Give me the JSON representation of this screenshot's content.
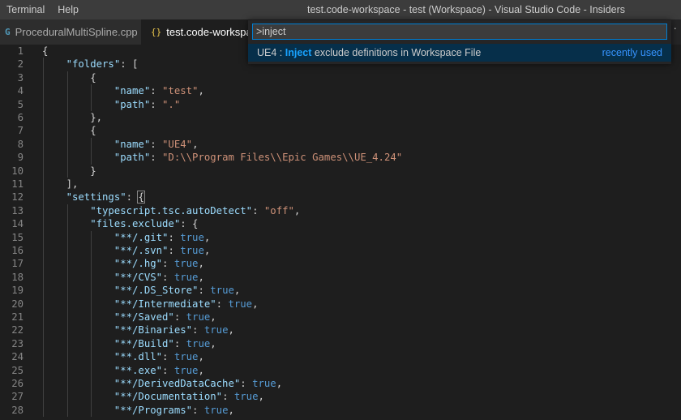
{
  "menu": {
    "items": [
      "Terminal",
      "Help"
    ]
  },
  "window": {
    "title": "test.code-workspace - test (Workspace) - Visual Studio Code - Insiders"
  },
  "tabs": [
    {
      "label": "ProceduralMultiSpline.cpp",
      "icon": "cpp-file-icon",
      "icon_glyph": "G"
    },
    {
      "label": "test.code-workspace",
      "icon": "json-braces-icon",
      "icon_glyph": "{}"
    }
  ],
  "more_actions": "···",
  "palette": {
    "input_value": ">inject",
    "result": {
      "prefix": "UE4 : ",
      "match": "Inject",
      "rest": " exclude definitions in Workspace File",
      "badge": "recently used"
    }
  },
  "editor": {
    "lines": [
      {
        "n": "1",
        "indent": 0,
        "tokens": [
          [
            "p",
            "{"
          ]
        ]
      },
      {
        "n": "2",
        "indent": 1,
        "tokens": [
          [
            "k",
            "\"folders\""
          ],
          [
            "p",
            ": ["
          ]
        ]
      },
      {
        "n": "3",
        "indent": 2,
        "tokens": [
          [
            "p",
            "{"
          ]
        ]
      },
      {
        "n": "4",
        "indent": 3,
        "tokens": [
          [
            "k",
            "\"name\""
          ],
          [
            "p",
            ": "
          ],
          [
            "s",
            "\"test\""
          ],
          [
            "p",
            ","
          ]
        ]
      },
      {
        "n": "5",
        "indent": 3,
        "tokens": [
          [
            "k",
            "\"path\""
          ],
          [
            "p",
            ": "
          ],
          [
            "s",
            "\".\""
          ]
        ]
      },
      {
        "n": "6",
        "indent": 2,
        "tokens": [
          [
            "p",
            "},"
          ]
        ]
      },
      {
        "n": "7",
        "indent": 2,
        "tokens": [
          [
            "p",
            "{"
          ]
        ]
      },
      {
        "n": "8",
        "indent": 3,
        "tokens": [
          [
            "k",
            "\"name\""
          ],
          [
            "p",
            ": "
          ],
          [
            "s",
            "\"UE4\""
          ],
          [
            "p",
            ","
          ]
        ]
      },
      {
        "n": "9",
        "indent": 3,
        "tokens": [
          [
            "k",
            "\"path\""
          ],
          [
            "p",
            ": "
          ],
          [
            "s",
            "\"D:\\\\Program Files\\\\Epic Games\\\\UE_4.24\""
          ]
        ]
      },
      {
        "n": "10",
        "indent": 2,
        "tokens": [
          [
            "p",
            "}"
          ]
        ]
      },
      {
        "n": "11",
        "indent": 1,
        "tokens": [
          [
            "p",
            "],"
          ]
        ]
      },
      {
        "n": "12",
        "indent": 1,
        "tokens": [
          [
            "k",
            "\"settings\""
          ],
          [
            "p",
            ": "
          ],
          [
            "h",
            "{"
          ]
        ]
      },
      {
        "n": "13",
        "indent": 2,
        "tokens": [
          [
            "k",
            "\"typescript.tsc.autoDetect\""
          ],
          [
            "p",
            ": "
          ],
          [
            "s",
            "\"off\""
          ],
          [
            "p",
            ","
          ]
        ]
      },
      {
        "n": "14",
        "indent": 2,
        "tokens": [
          [
            "k",
            "\"files.exclude\""
          ],
          [
            "p",
            ": {"
          ]
        ]
      },
      {
        "n": "15",
        "indent": 3,
        "tokens": [
          [
            "k",
            "\"**/.git\""
          ],
          [
            "p",
            ": "
          ],
          [
            "b",
            "true"
          ],
          [
            "p",
            ","
          ]
        ]
      },
      {
        "n": "16",
        "indent": 3,
        "tokens": [
          [
            "k",
            "\"**/.svn\""
          ],
          [
            "p",
            ": "
          ],
          [
            "b",
            "true"
          ],
          [
            "p",
            ","
          ]
        ]
      },
      {
        "n": "17",
        "indent": 3,
        "tokens": [
          [
            "k",
            "\"**/.hg\""
          ],
          [
            "p",
            ": "
          ],
          [
            "b",
            "true"
          ],
          [
            "p",
            ","
          ]
        ]
      },
      {
        "n": "18",
        "indent": 3,
        "tokens": [
          [
            "k",
            "\"**/CVS\""
          ],
          [
            "p",
            ": "
          ],
          [
            "b",
            "true"
          ],
          [
            "p",
            ","
          ]
        ]
      },
      {
        "n": "19",
        "indent": 3,
        "tokens": [
          [
            "k",
            "\"**/.DS_Store\""
          ],
          [
            "p",
            ": "
          ],
          [
            "b",
            "true"
          ],
          [
            "p",
            ","
          ]
        ]
      },
      {
        "n": "20",
        "indent": 3,
        "tokens": [
          [
            "k",
            "\"**/Intermediate\""
          ],
          [
            "p",
            ": "
          ],
          [
            "b",
            "true"
          ],
          [
            "p",
            ","
          ]
        ]
      },
      {
        "n": "21",
        "indent": 3,
        "tokens": [
          [
            "k",
            "\"**/Saved\""
          ],
          [
            "p",
            ": "
          ],
          [
            "b",
            "true"
          ],
          [
            "p",
            ","
          ]
        ]
      },
      {
        "n": "22",
        "indent": 3,
        "tokens": [
          [
            "k",
            "\"**/Binaries\""
          ],
          [
            "p",
            ": "
          ],
          [
            "b",
            "true"
          ],
          [
            "p",
            ","
          ]
        ]
      },
      {
        "n": "23",
        "indent": 3,
        "tokens": [
          [
            "k",
            "\"**/Build\""
          ],
          [
            "p",
            ": "
          ],
          [
            "b",
            "true"
          ],
          [
            "p",
            ","
          ]
        ]
      },
      {
        "n": "24",
        "indent": 3,
        "tokens": [
          [
            "k",
            "\"**.dll\""
          ],
          [
            "p",
            ": "
          ],
          [
            "b",
            "true"
          ],
          [
            "p",
            ","
          ]
        ]
      },
      {
        "n": "25",
        "indent": 3,
        "tokens": [
          [
            "k",
            "\"**.exe\""
          ],
          [
            "p",
            ": "
          ],
          [
            "b",
            "true"
          ],
          [
            "p",
            ","
          ]
        ]
      },
      {
        "n": "26",
        "indent": 3,
        "tokens": [
          [
            "k",
            "\"**/DerivedDataCache\""
          ],
          [
            "p",
            ": "
          ],
          [
            "b",
            "true"
          ],
          [
            "p",
            ","
          ]
        ]
      },
      {
        "n": "27",
        "indent": 3,
        "tokens": [
          [
            "k",
            "\"**/Documentation\""
          ],
          [
            "p",
            ": "
          ],
          [
            "b",
            "true"
          ],
          [
            "p",
            ","
          ]
        ]
      },
      {
        "n": "28",
        "indent": 3,
        "tokens": [
          [
            "k",
            "\"**/Programs\""
          ],
          [
            "p",
            ": "
          ],
          [
            "b",
            "true"
          ],
          [
            "p",
            ","
          ]
        ]
      }
    ]
  },
  "colors": {
    "key": "#9cdcfe",
    "string": "#ce9178",
    "boolean": "#569cd6",
    "punctuation": "#d4d4d4",
    "accent": "#007fd4",
    "selection": "#062f4a"
  }
}
